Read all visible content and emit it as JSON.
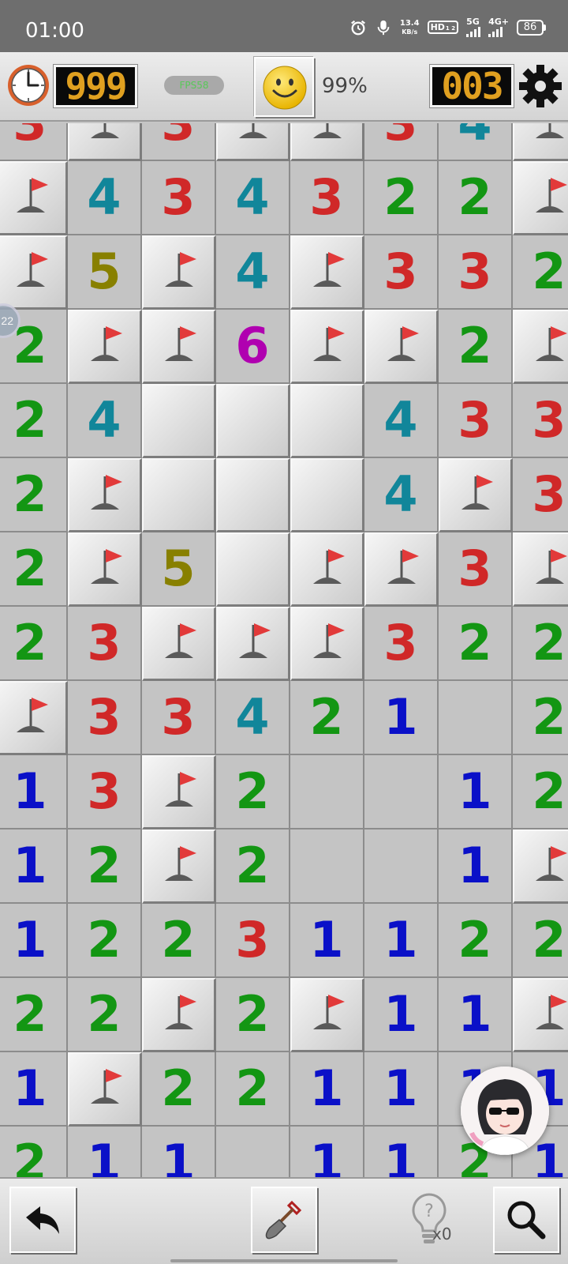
{
  "status_bar": {
    "time": "01:00",
    "net_speed_value": "13.4",
    "net_speed_unit": "KB/s",
    "hd_label": "HD",
    "hd_sub": "1 2",
    "sig1_label": "5G",
    "sig2_label": "4G+",
    "battery": "86"
  },
  "header": {
    "timer": "999",
    "fps_label": "FPS58",
    "percent": "99%",
    "mines_left": "003",
    "hint_bubble": "22"
  },
  "board": {
    "columns": 8,
    "rows": [
      [
        "3",
        "F",
        "3",
        "F",
        "F",
        "3",
        "4",
        "F"
      ],
      [
        "F",
        "4",
        "3",
        "4",
        "3",
        "2",
        "2",
        "F"
      ],
      [
        "F",
        "5",
        "F",
        "4",
        "F",
        "3",
        "3",
        "2"
      ],
      [
        "2",
        "F",
        "F",
        "6",
        "F",
        "F",
        "2",
        "F"
      ],
      [
        "2",
        "4",
        "C",
        "C",
        "C",
        "4",
        "3",
        "3"
      ],
      [
        "2",
        "F",
        "C",
        "C",
        "C",
        "4",
        "F",
        "3"
      ],
      [
        "2",
        "F",
        "5",
        "C",
        "F",
        "F",
        "3",
        "F"
      ],
      [
        "2",
        "3",
        "F",
        "F",
        "F",
        "3",
        "2",
        "2"
      ],
      [
        "F",
        "3",
        "3",
        "4",
        "2",
        "1",
        "",
        "2"
      ],
      [
        "1",
        "3",
        "F",
        "2",
        "",
        "",
        "1",
        "2"
      ],
      [
        "1",
        "2",
        "F",
        "2",
        "",
        "",
        "1",
        "F"
      ],
      [
        "1",
        "2",
        "2",
        "3",
        "1",
        "1",
        "2",
        "2"
      ],
      [
        "2",
        "2",
        "F",
        "2",
        "F",
        "1",
        "1",
        "F"
      ],
      [
        "1",
        "F",
        "2",
        "2",
        "1",
        "1",
        "1",
        "1"
      ],
      [
        "2",
        "1",
        "1",
        "",
        "1",
        "1",
        "2",
        "1"
      ]
    ],
    "legend": {
      "F": "flag-icon",
      "C": "covered-cell",
      "": "empty-cell"
    }
  },
  "toolbar": {
    "undo_icon": "undo-arrow-icon",
    "dig_icon": "shovel-icon",
    "hint_icon": "lightbulb-question-icon",
    "hint_count": "x0",
    "zoom_icon": "magnifier-icon"
  }
}
